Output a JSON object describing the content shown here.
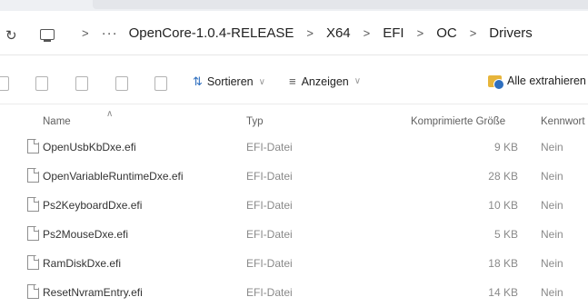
{
  "address": {
    "crumbs": [
      "OpenCore-1.0.4-RELEASE",
      "X64",
      "EFI",
      "OC",
      "Drivers"
    ],
    "more": "···",
    "separator": ">"
  },
  "toolbar": {
    "sort_label": "Sortieren",
    "view_label": "Anzeigen",
    "extract_label": "Alle extrahieren",
    "icons": [
      "cut-icon",
      "copy-icon",
      "paste-icon",
      "share-icon",
      "delete-icon"
    ]
  },
  "columns": {
    "name": "Name",
    "type": "Typ",
    "size": "Komprimierte Größe",
    "password": "Kennwort"
  },
  "files": [
    {
      "name": "OpenUsbKbDxe.efi",
      "type": "EFI-Datei",
      "size": "9 KB",
      "password": "Nein"
    },
    {
      "name": "OpenVariableRuntimeDxe.efi",
      "type": "EFI-Datei",
      "size": "28 KB",
      "password": "Nein"
    },
    {
      "name": "Ps2KeyboardDxe.efi",
      "type": "EFI-Datei",
      "size": "10 KB",
      "password": "Nein"
    },
    {
      "name": "Ps2MouseDxe.efi",
      "type": "EFI-Datei",
      "size": "5 KB",
      "password": "Nein"
    },
    {
      "name": "RamDiskDxe.efi",
      "type": "EFI-Datei",
      "size": "18 KB",
      "password": "Nein"
    },
    {
      "name": "ResetNvramEntry.efi",
      "type": "EFI-Datei",
      "size": "14 KB",
      "password": "Nein"
    }
  ]
}
